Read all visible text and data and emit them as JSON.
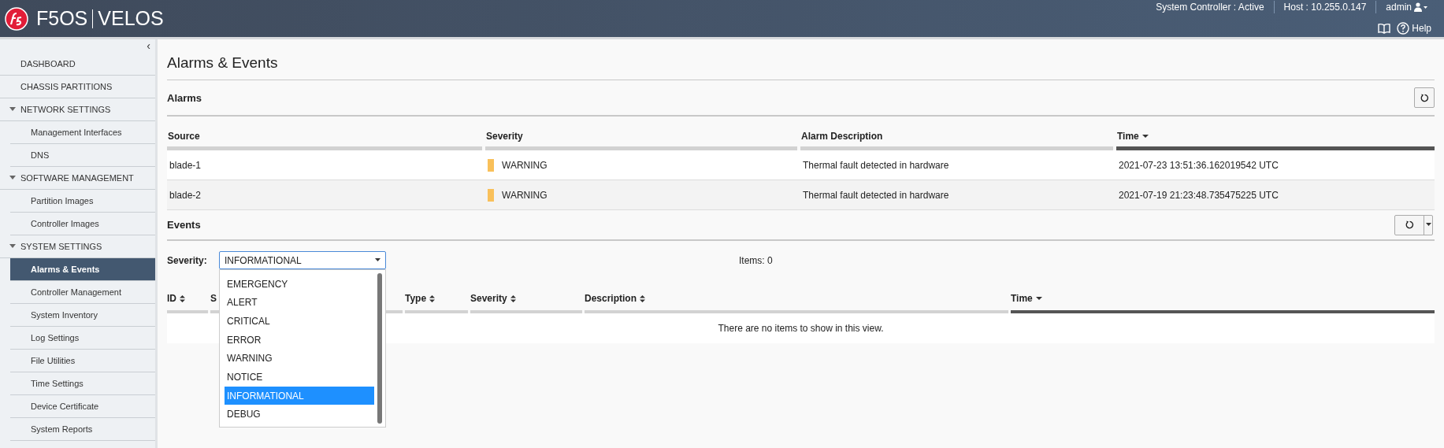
{
  "header": {
    "product": "F5OS",
    "platform": "VELOS",
    "status": "System Controller : Active",
    "host": "Host : 10.255.0.147",
    "user": "admin",
    "help": "Help"
  },
  "sidebar": {
    "collapse": "‹",
    "items": [
      {
        "label": "DASHBOARD",
        "selected": false
      },
      {
        "label": "CHASSIS PARTITIONS",
        "selected": false
      },
      {
        "label": "NETWORK SETTINGS",
        "selected": false,
        "expanded": true,
        "children": [
          {
            "label": "Management Interfaces",
            "selected": false
          },
          {
            "label": "DNS",
            "selected": false
          }
        ]
      },
      {
        "label": "SOFTWARE MANAGEMENT",
        "selected": false,
        "expanded": true,
        "children": [
          {
            "label": "Partition Images",
            "selected": false
          },
          {
            "label": "Controller Images",
            "selected": false
          }
        ]
      },
      {
        "label": "SYSTEM SETTINGS",
        "selected": false,
        "expanded": true,
        "children": [
          {
            "label": "Alarms & Events",
            "selected": true
          },
          {
            "label": "Controller Management",
            "selected": false
          },
          {
            "label": "System Inventory",
            "selected": false
          },
          {
            "label": "Log Settings",
            "selected": false
          },
          {
            "label": "File Utilities",
            "selected": false
          },
          {
            "label": "Time Settings",
            "selected": false
          },
          {
            "label": "Device Certificate",
            "selected": false
          },
          {
            "label": "System Reports",
            "selected": false
          }
        ]
      }
    ]
  },
  "page_title": "Alarms & Events",
  "alarms": {
    "title": "Alarms",
    "columns": [
      {
        "label": "Source",
        "sorted": false
      },
      {
        "label": "Severity",
        "sorted": false
      },
      {
        "label": "Alarm Description",
        "sorted": false
      },
      {
        "label": "Time",
        "sorted": true
      }
    ],
    "rows": [
      {
        "source": "blade-1",
        "severity": "WARNING",
        "color": "#f9c05a",
        "description": "Thermal fault detected in hardware",
        "time": "2021-07-23 13:51:36.162019542 UTC"
      },
      {
        "source": "blade-2",
        "severity": "WARNING",
        "color": "#f9c05a",
        "description": "Thermal fault detected in hardware",
        "time": "2021-07-19 21:23:48.735475225 UTC"
      }
    ]
  },
  "events": {
    "title": "Events",
    "filter_label": "Severity:",
    "filter_value": "INFORMATIONAL",
    "items_count": "Items: 0",
    "options": [
      {
        "label": "EMERGENCY",
        "selected": false
      },
      {
        "label": "ALERT",
        "selected": false
      },
      {
        "label": "CRITICAL",
        "selected": false
      },
      {
        "label": "ERROR",
        "selected": false
      },
      {
        "label": "WARNING",
        "selected": false
      },
      {
        "label": "NOTICE",
        "selected": false
      },
      {
        "label": "INFORMATIONAL",
        "selected": true
      },
      {
        "label": "DEBUG",
        "selected": false
      }
    ],
    "columns": [
      {
        "label": "ID",
        "sorted": false
      },
      {
        "label": "S"
      },
      {
        "label": "Type",
        "sorted": false
      },
      {
        "label": "Severity",
        "sorted": false
      },
      {
        "label": "Description",
        "sorted": false
      },
      {
        "label": "Time",
        "sorted": true
      }
    ],
    "empty_message": "There are no items to show in this view."
  }
}
